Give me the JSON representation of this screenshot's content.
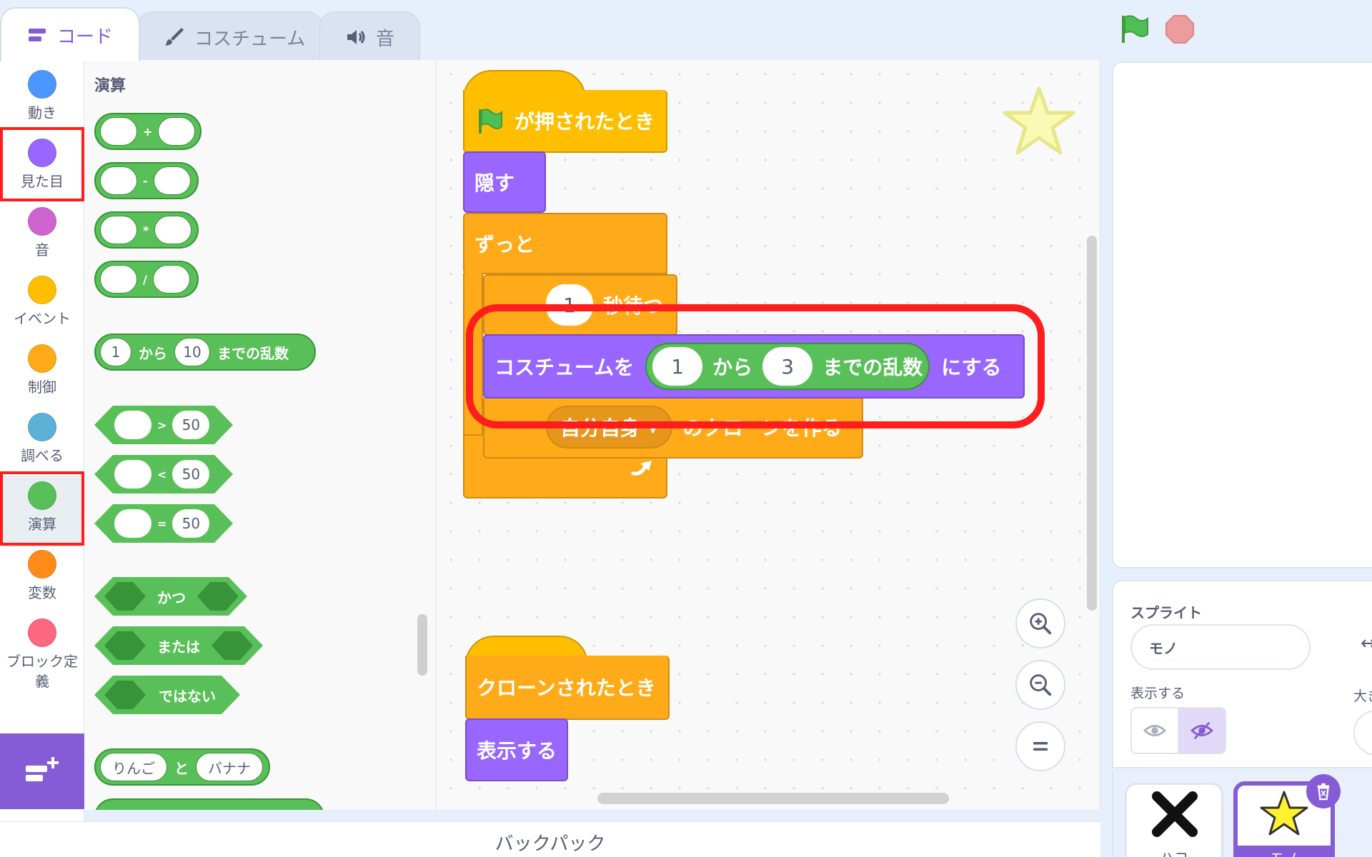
{
  "tabs": [
    {
      "label": "コード",
      "icon": "code-icon",
      "active": true
    },
    {
      "label": "コスチューム",
      "icon": "paintbrush-icon",
      "active": false
    },
    {
      "label": "音",
      "icon": "speaker-icon",
      "active": false
    }
  ],
  "top_controls": {
    "green_flag": "green-flag-icon",
    "stop": "stop-icon"
  },
  "categories": [
    {
      "label": "動き",
      "color": "#4c97ff"
    },
    {
      "label": "見た目",
      "color": "#9966ff"
    },
    {
      "label": "音",
      "color": "#cf63cf"
    },
    {
      "label": "イベント",
      "color": "#ffbf00"
    },
    {
      "label": "制御",
      "color": "#ffab19"
    },
    {
      "label": "調べる",
      "color": "#5cb1d6"
    },
    {
      "label": "演算",
      "color": "#59c059"
    },
    {
      "label": "変数",
      "color": "#ff8c1a"
    },
    {
      "label": "ブロック定義",
      "color": "#ff6680"
    }
  ],
  "palette": {
    "title": "演算",
    "add_op": "+",
    "sub_op": "-",
    "mul_op": "*",
    "div_op": "/",
    "random": {
      "from": "1",
      "from_label": "から",
      "to": "10",
      "to_label": "までの乱数"
    },
    "gt": {
      "op": ">",
      "value": "50"
    },
    "lt": {
      "op": "<",
      "value": "50"
    },
    "eq": {
      "op": "=",
      "value": "50"
    },
    "and_label": "かつ",
    "or_label": "または",
    "not_label": "ではない",
    "join": {
      "a": "りんご",
      "mid": "と",
      "b": "バナナ"
    }
  },
  "script1": {
    "hat": "が押されたとき",
    "hide": "隠す",
    "forever": "ずっと",
    "wait_value": "1",
    "wait_label": "秒待つ",
    "clone_menu": "自分自身",
    "clone_label": "のクローンを作る",
    "costume": {
      "prefix": "コスチュームを",
      "from": "1",
      "from_label": "から",
      "to": "3",
      "to_label": "までの乱数",
      "suffix": "にする"
    }
  },
  "script2": {
    "hat": "クローンされたとき",
    "show": "表示する"
  },
  "backpack": {
    "label": "バックパック"
  },
  "sprite_info": {
    "sprite_label": "スプライト",
    "sprite_name": "モノ",
    "show_label": "表示する",
    "size_label": "大き"
  },
  "sprites": [
    {
      "name": "ハコ",
      "selected": false
    },
    {
      "name": "モノ",
      "selected": true
    }
  ]
}
